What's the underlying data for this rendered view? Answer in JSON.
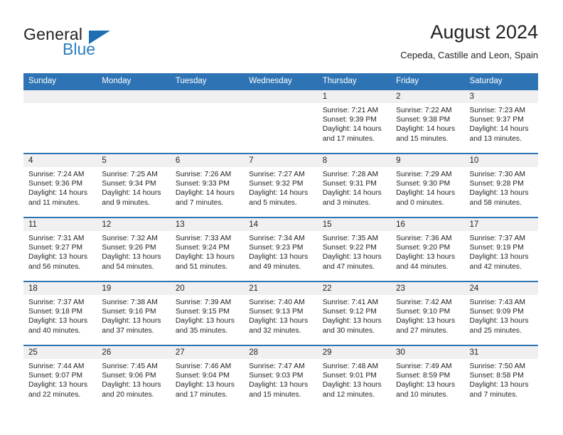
{
  "brand": {
    "name_part1": "General",
    "name_part2": "Blue",
    "triangle_color": "#1f6fb5",
    "blue_color": "#2a7ec0"
  },
  "header": {
    "title": "August 2024",
    "subtitle": "Cepeda, Castille and Leon, Spain"
  },
  "theme": {
    "header_bg": "#2e74b5",
    "header_text": "#ffffff",
    "daynum_bg": "#f0f0f0",
    "body_text": "#231f20",
    "row_rule": "#2e74b5"
  },
  "weekday_headers": [
    "Sunday",
    "Monday",
    "Tuesday",
    "Wednesday",
    "Thursday",
    "Friday",
    "Saturday"
  ],
  "labels": {
    "sunrise_prefix": "Sunrise:",
    "sunset_prefix": "Sunset:",
    "daylight_prefix": "Daylight:"
  },
  "weeks": [
    [
      {
        "empty": true
      },
      {
        "empty": true
      },
      {
        "empty": true
      },
      {
        "empty": true
      },
      {
        "day": "1",
        "sunrise": "Sunrise: 7:21 AM",
        "sunset": "Sunset: 9:39 PM",
        "daylight": "Daylight: 14 hours and 17 minutes."
      },
      {
        "day": "2",
        "sunrise": "Sunrise: 7:22 AM",
        "sunset": "Sunset: 9:38 PM",
        "daylight": "Daylight: 14 hours and 15 minutes."
      },
      {
        "day": "3",
        "sunrise": "Sunrise: 7:23 AM",
        "sunset": "Sunset: 9:37 PM",
        "daylight": "Daylight: 14 hours and 13 minutes."
      }
    ],
    [
      {
        "day": "4",
        "sunrise": "Sunrise: 7:24 AM",
        "sunset": "Sunset: 9:36 PM",
        "daylight": "Daylight: 14 hours and 11 minutes."
      },
      {
        "day": "5",
        "sunrise": "Sunrise: 7:25 AM",
        "sunset": "Sunset: 9:34 PM",
        "daylight": "Daylight: 14 hours and 9 minutes."
      },
      {
        "day": "6",
        "sunrise": "Sunrise: 7:26 AM",
        "sunset": "Sunset: 9:33 PM",
        "daylight": "Daylight: 14 hours and 7 minutes."
      },
      {
        "day": "7",
        "sunrise": "Sunrise: 7:27 AM",
        "sunset": "Sunset: 9:32 PM",
        "daylight": "Daylight: 14 hours and 5 minutes."
      },
      {
        "day": "8",
        "sunrise": "Sunrise: 7:28 AM",
        "sunset": "Sunset: 9:31 PM",
        "daylight": "Daylight: 14 hours and 3 minutes."
      },
      {
        "day": "9",
        "sunrise": "Sunrise: 7:29 AM",
        "sunset": "Sunset: 9:30 PM",
        "daylight": "Daylight: 14 hours and 0 minutes."
      },
      {
        "day": "10",
        "sunrise": "Sunrise: 7:30 AM",
        "sunset": "Sunset: 9:28 PM",
        "daylight": "Daylight: 13 hours and 58 minutes."
      }
    ],
    [
      {
        "day": "11",
        "sunrise": "Sunrise: 7:31 AM",
        "sunset": "Sunset: 9:27 PM",
        "daylight": "Daylight: 13 hours and 56 minutes."
      },
      {
        "day": "12",
        "sunrise": "Sunrise: 7:32 AM",
        "sunset": "Sunset: 9:26 PM",
        "daylight": "Daylight: 13 hours and 54 minutes."
      },
      {
        "day": "13",
        "sunrise": "Sunrise: 7:33 AM",
        "sunset": "Sunset: 9:24 PM",
        "daylight": "Daylight: 13 hours and 51 minutes."
      },
      {
        "day": "14",
        "sunrise": "Sunrise: 7:34 AM",
        "sunset": "Sunset: 9:23 PM",
        "daylight": "Daylight: 13 hours and 49 minutes."
      },
      {
        "day": "15",
        "sunrise": "Sunrise: 7:35 AM",
        "sunset": "Sunset: 9:22 PM",
        "daylight": "Daylight: 13 hours and 47 minutes."
      },
      {
        "day": "16",
        "sunrise": "Sunrise: 7:36 AM",
        "sunset": "Sunset: 9:20 PM",
        "daylight": "Daylight: 13 hours and 44 minutes."
      },
      {
        "day": "17",
        "sunrise": "Sunrise: 7:37 AM",
        "sunset": "Sunset: 9:19 PM",
        "daylight": "Daylight: 13 hours and 42 minutes."
      }
    ],
    [
      {
        "day": "18",
        "sunrise": "Sunrise: 7:37 AM",
        "sunset": "Sunset: 9:18 PM",
        "daylight": "Daylight: 13 hours and 40 minutes."
      },
      {
        "day": "19",
        "sunrise": "Sunrise: 7:38 AM",
        "sunset": "Sunset: 9:16 PM",
        "daylight": "Daylight: 13 hours and 37 minutes."
      },
      {
        "day": "20",
        "sunrise": "Sunrise: 7:39 AM",
        "sunset": "Sunset: 9:15 PM",
        "daylight": "Daylight: 13 hours and 35 minutes."
      },
      {
        "day": "21",
        "sunrise": "Sunrise: 7:40 AM",
        "sunset": "Sunset: 9:13 PM",
        "daylight": "Daylight: 13 hours and 32 minutes."
      },
      {
        "day": "22",
        "sunrise": "Sunrise: 7:41 AM",
        "sunset": "Sunset: 9:12 PM",
        "daylight": "Daylight: 13 hours and 30 minutes."
      },
      {
        "day": "23",
        "sunrise": "Sunrise: 7:42 AM",
        "sunset": "Sunset: 9:10 PM",
        "daylight": "Daylight: 13 hours and 27 minutes."
      },
      {
        "day": "24",
        "sunrise": "Sunrise: 7:43 AM",
        "sunset": "Sunset: 9:09 PM",
        "daylight": "Daylight: 13 hours and 25 minutes."
      }
    ],
    [
      {
        "day": "25",
        "sunrise": "Sunrise: 7:44 AM",
        "sunset": "Sunset: 9:07 PM",
        "daylight": "Daylight: 13 hours and 22 minutes."
      },
      {
        "day": "26",
        "sunrise": "Sunrise: 7:45 AM",
        "sunset": "Sunset: 9:06 PM",
        "daylight": "Daylight: 13 hours and 20 minutes."
      },
      {
        "day": "27",
        "sunrise": "Sunrise: 7:46 AM",
        "sunset": "Sunset: 9:04 PM",
        "daylight": "Daylight: 13 hours and 17 minutes."
      },
      {
        "day": "28",
        "sunrise": "Sunrise: 7:47 AM",
        "sunset": "Sunset: 9:03 PM",
        "daylight": "Daylight: 13 hours and 15 minutes."
      },
      {
        "day": "29",
        "sunrise": "Sunrise: 7:48 AM",
        "sunset": "Sunset: 9:01 PM",
        "daylight": "Daylight: 13 hours and 12 minutes."
      },
      {
        "day": "30",
        "sunrise": "Sunrise: 7:49 AM",
        "sunset": "Sunset: 8:59 PM",
        "daylight": "Daylight: 13 hours and 10 minutes."
      },
      {
        "day": "31",
        "sunrise": "Sunrise: 7:50 AM",
        "sunset": "Sunset: 8:58 PM",
        "daylight": "Daylight: 13 hours and 7 minutes."
      }
    ]
  ]
}
